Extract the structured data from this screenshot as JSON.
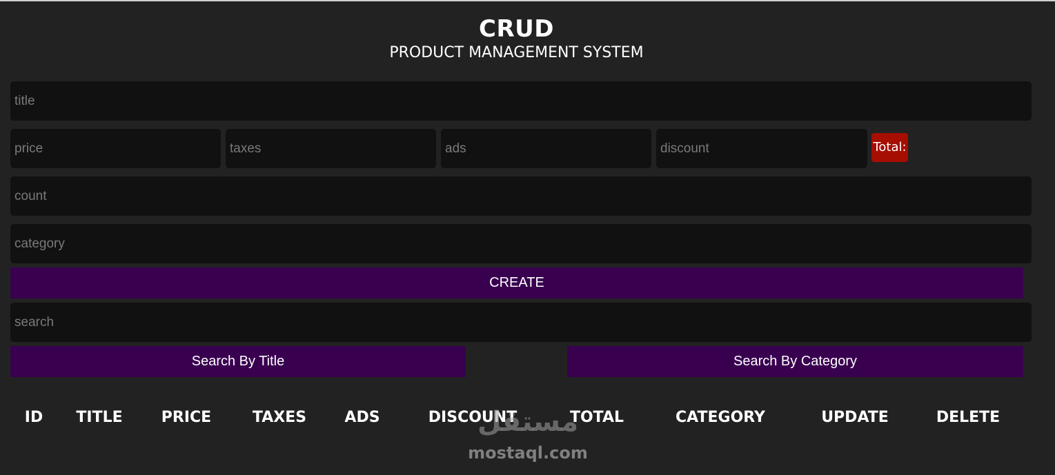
{
  "header": {
    "title": "CRUD",
    "subtitle": "PRODUCT MANAGEMENT SYSTEM"
  },
  "form": {
    "title_placeholder": "title",
    "price_placeholder": "price",
    "taxes_placeholder": "taxes",
    "ads_placeholder": "ads",
    "discount_placeholder": "discount",
    "total_label": "Total:",
    "count_placeholder": "count",
    "category_placeholder": "category",
    "create_label": "CREATE"
  },
  "search": {
    "placeholder": "search",
    "by_title_label": "Search By Title",
    "by_category_label": "Search By Category"
  },
  "table": {
    "headers": [
      "ID",
      "TITLE",
      "PRICE",
      "TAXES",
      "ADS",
      "DISCOUNT",
      "TOTAL",
      "CATEGORY",
      "UPDATE",
      "DELETE"
    ]
  },
  "watermark": {
    "arabic": "مستقل",
    "latin": "mostaql.com"
  },
  "colors": {
    "background": "#222222",
    "input_background": "#111111",
    "button": "#390050",
    "total_badge": "#a50e00"
  }
}
